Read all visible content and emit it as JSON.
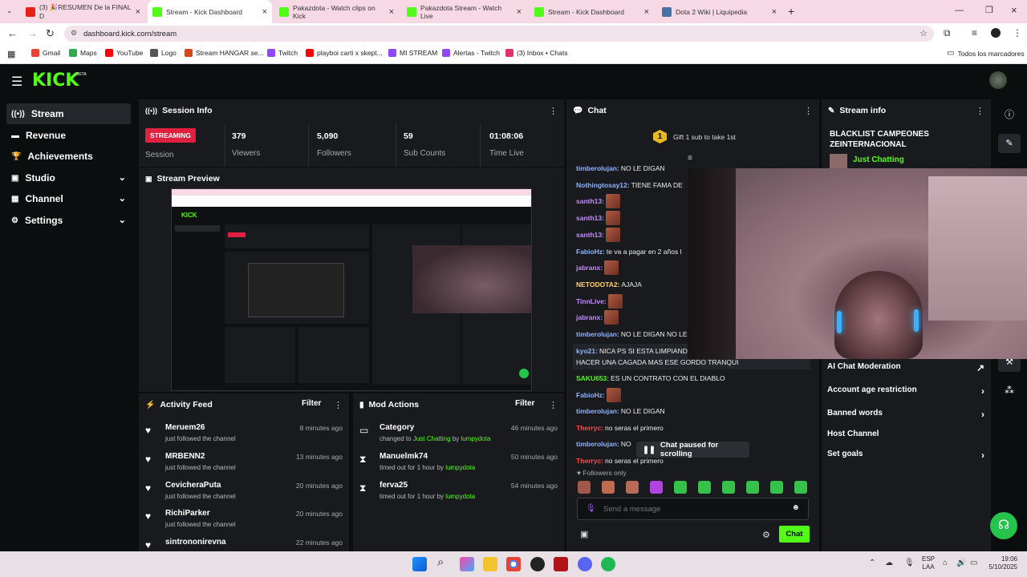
{
  "browser": {
    "tabs": [
      {
        "label": "(3) 🎉RESUMEN De la FINAL D",
        "favicon_color": "#e62117"
      },
      {
        "label": "Stream - Kick Dashboard",
        "favicon_color": "#53fc18"
      },
      {
        "label": "Pakazdota - Watch clips on Kick",
        "favicon_color": "#53fc18"
      },
      {
        "label": "Pakazdota Stream - Watch Live",
        "favicon_color": "#53fc18"
      },
      {
        "label": "Stream - Kick Dashboard",
        "favicon_color": "#53fc18"
      },
      {
        "label": "Dota 2 Wiki | Liquipedia",
        "favicon_color": "#4a6fa5"
      }
    ],
    "url": "dashboard.kick.com/stream",
    "bookmarks": [
      {
        "label": "Gmail",
        "color": "#ea4335"
      },
      {
        "label": "Maps",
        "color": "#34a853"
      },
      {
        "label": "YouTube",
        "color": "#ff0000"
      },
      {
        "label": "Logo",
        "color": "#555555"
      },
      {
        "label": "Stream HANGAR se...",
        "color": "#d04a1e"
      },
      {
        "label": "Twitch",
        "color": "#9146ff"
      },
      {
        "label": "playboi carti x skept...",
        "color": "#ff0000"
      },
      {
        "label": "MI STREAM",
        "color": "#9146ff"
      },
      {
        "label": "Alertas - Twitch",
        "color": "#9146ff"
      },
      {
        "label": "(3) Inbox • Chats",
        "color": "#e1306c"
      }
    ],
    "all_bookmarks": "Todos los marcadores"
  },
  "kick": {
    "logo": "KICK",
    "beta": "BETA",
    "accent": "#53fc18"
  },
  "sidebar": {
    "items": [
      {
        "label": "Stream",
        "icon": "stream-icon"
      },
      {
        "label": "Revenue",
        "icon": "revenue-icon"
      },
      {
        "label": "Achievements",
        "icon": "trophy-icon"
      },
      {
        "label": "Studio",
        "icon": "studio-icon"
      },
      {
        "label": "Channel",
        "icon": "channel-icon"
      },
      {
        "label": "Settings",
        "icon": "gear-icon"
      }
    ]
  },
  "session": {
    "title": "Session Info",
    "badge": "STREAMING",
    "session_label": "Session",
    "stats": [
      {
        "value": "379",
        "label": "Viewers"
      },
      {
        "value": "5,090",
        "label": "Followers"
      },
      {
        "value": "59",
        "label": "Sub Counts"
      },
      {
        "value": "01:08:06",
        "label": "Time Live"
      }
    ]
  },
  "preview": {
    "title": "Stream Preview"
  },
  "activity": {
    "title": "Activity Feed",
    "filter": "Filter",
    "rows": [
      {
        "name": "Meruem26",
        "sub": "just followed the channel",
        "time": "8 minutes ago"
      },
      {
        "name": "MRBENN2",
        "sub": "just followed the channel",
        "time": "13 minutes ago"
      },
      {
        "name": "CevicheraPuta",
        "sub": "just followed the channel",
        "time": "20 minutes ago"
      },
      {
        "name": "RichiParker",
        "sub": "just followed the channel",
        "time": "20 minutes ago"
      },
      {
        "name": "sintrononirevna",
        "sub": "",
        "time": "22 minutes ago"
      }
    ]
  },
  "mod": {
    "title": "Mod Actions",
    "filter": "Filter",
    "rows": [
      {
        "name": "Category",
        "pre": "changed to",
        "target": "Just Chatting",
        "by": "by",
        "mod": "lumpydota",
        "time": "46 minutes ago"
      },
      {
        "name": "Manuelmk74",
        "pre": "timed out for 1 hour by",
        "target": "",
        "by": "",
        "mod": "lumpydota",
        "time": "50 minutes ago"
      },
      {
        "name": "ferva25",
        "pre": "timed out for 1 hour by",
        "target": "",
        "by": "",
        "mod": "lumpydota",
        "time": "54 minutes ago"
      }
    ]
  },
  "chat": {
    "title": "Chat",
    "gift": "Gift 1 sub to take 1st",
    "gift_count": "1",
    "messages": [
      {
        "user": "timberolujan",
        "color": "#8fb3ff",
        "text": "NO LE DIGAN"
      },
      {
        "user": "Nothingtosay12",
        "color": "#8fb3ff",
        "text": "TIENE FAMA DE"
      },
      {
        "user": "santh13",
        "color": "#c58bff",
        "text": "",
        "emote": true
      },
      {
        "user": "santh13",
        "color": "#c58bff",
        "text": "",
        "emote": true
      },
      {
        "user": "santh13",
        "color": "#c58bff",
        "text": "",
        "emote": true
      },
      {
        "user": "FabioHz",
        "color": "#8fb3ff",
        "text": "te va a pagar en 2 años l"
      },
      {
        "user": "jabranx",
        "color": "#c58bff",
        "text": "",
        "emote": true
      },
      {
        "user": "NETODOTA2",
        "color": "#ffd36b",
        "text": "AJAJA"
      },
      {
        "user": "TinnLive",
        "color": "#c58bff",
        "text": "",
        "emote": true
      },
      {
        "user": "jabranx",
        "color": "#c58bff",
        "text": "",
        "emote": true
      },
      {
        "user": "timberolujan",
        "color": "#8fb3ff",
        "text": "NO LE DIGAN NO LE"
      },
      {
        "user": "kyo21",
        "color": "#8fb3ff",
        "text": "NICA PS SI ESTA LIMPIAND"
      },
      {
        "user": "",
        "color": "#8fb3ff",
        "text": "HACER UNA CAGADA MAS ESE GORDO TRANQUI"
      },
      {
        "user": "SAKU653",
        "color": "#53fc18",
        "text": "ES UN CONTRATO CON EL DIABLO"
      },
      {
        "user": "FabioHz",
        "color": "#8fb3ff",
        "text": "",
        "emote": true
      },
      {
        "user": "timberolujan",
        "color": "#8fb3ff",
        "text": "NO LE DIGAN"
      },
      {
        "user": "Therryc",
        "color": "#ff4d4d",
        "text": "no seras el primero"
      },
      {
        "user": "timberolujan",
        "color": "#8fb3ff",
        "text": "NO"
      },
      {
        "user": "Therryc",
        "color": "#ff4d4d",
        "text": "no seras el primero"
      }
    ],
    "paused": "Chat paused for scrolling",
    "followers_only": "Followers only",
    "placeholder": "Send a message",
    "send": "Chat"
  },
  "stream_info": {
    "title": "Stream info",
    "stream_title": "BLACKLIST CAMPEONES ZEINTERNACIONAL",
    "category": "Just Chatting",
    "items": [
      {
        "label": "AI Chat Moderation",
        "arrow": "↗"
      },
      {
        "label": "Account age restriction",
        "arrow": "›"
      },
      {
        "label": "Banned words",
        "arrow": "›"
      },
      {
        "label": "Host Channel",
        "arrow": ""
      },
      {
        "label": "Set goals",
        "arrow": "›"
      }
    ]
  },
  "taskbar": {
    "lang": "ESP",
    "lang2": "LAA",
    "time": "19:06",
    "date": "5/10/2025"
  }
}
